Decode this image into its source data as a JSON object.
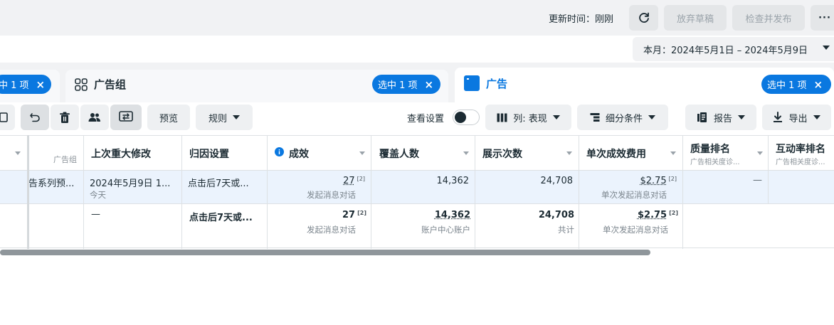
{
  "topbar": {
    "update_time": "更新时间：刚刚",
    "refresh_icon": "refresh-icon",
    "discard_label": "放弃草稿",
    "publish_label": "检查并发布",
    "more_label": "···"
  },
  "date_range": {
    "label": "本月：2024年5月1日 – 2024年5月9日"
  },
  "tabs": {
    "campaign": {
      "pill": "中 1 项",
      "close": "×"
    },
    "adset": {
      "title": "广告组",
      "pill": "选中 1 项",
      "close": "×",
      "icon": "adset-grid-icon"
    },
    "ad": {
      "title": "广告",
      "pill": "选中 1 项",
      "close": "×",
      "icon": "ad-icon"
    }
  },
  "toolbar": {
    "preview": "预览",
    "rules": "规则",
    "view_settings": "查看设置",
    "columns": "列: 表现",
    "breakdown": "细分条件",
    "reports": "报告",
    "export": "导出"
  },
  "table": {
    "headers": {
      "adset_sub": "广告组",
      "last_edit": "上次重大修改",
      "attribution": "归因设置",
      "results": "成效",
      "reach": "覆盖人数",
      "impressions": "展示次数",
      "cost_per_result": "单次成效费用",
      "quality_rank": "质量排名",
      "quality_rank_sub": "广告相关度诊...",
      "engagement_rank": "互动率排名",
      "engagement_rank_sub": "广告相关度诊..."
    },
    "row1": {
      "adset_name": "告系列预...",
      "last_edit": "2024年5月9日 1...",
      "last_edit_sub": "今天",
      "attribution": "点击后7天或...",
      "results": "27",
      "results_sup": "[2]",
      "results_sub": "发起消息对话",
      "reach": "14,362",
      "impressions": "24,708",
      "cost": "$2.75",
      "cost_sup": "[2]",
      "cost_sub": "单次发起消息对话",
      "quality_rank": "—"
    },
    "row2": {
      "last_edit": "—",
      "attribution": "点击后7天或...",
      "results": "27",
      "results_sup": "[2]",
      "results_sub": "发起消息对话",
      "reach": "14,362",
      "reach_sub": "账户中心账户",
      "impressions": "24,708",
      "impressions_sub": "共计",
      "cost": "$2.75",
      "cost_sup": "[2]",
      "cost_sub": "单次发起消息对话"
    }
  },
  "colors": {
    "accent": "#0a78e0",
    "row_selected": "#ebf3fd"
  }
}
